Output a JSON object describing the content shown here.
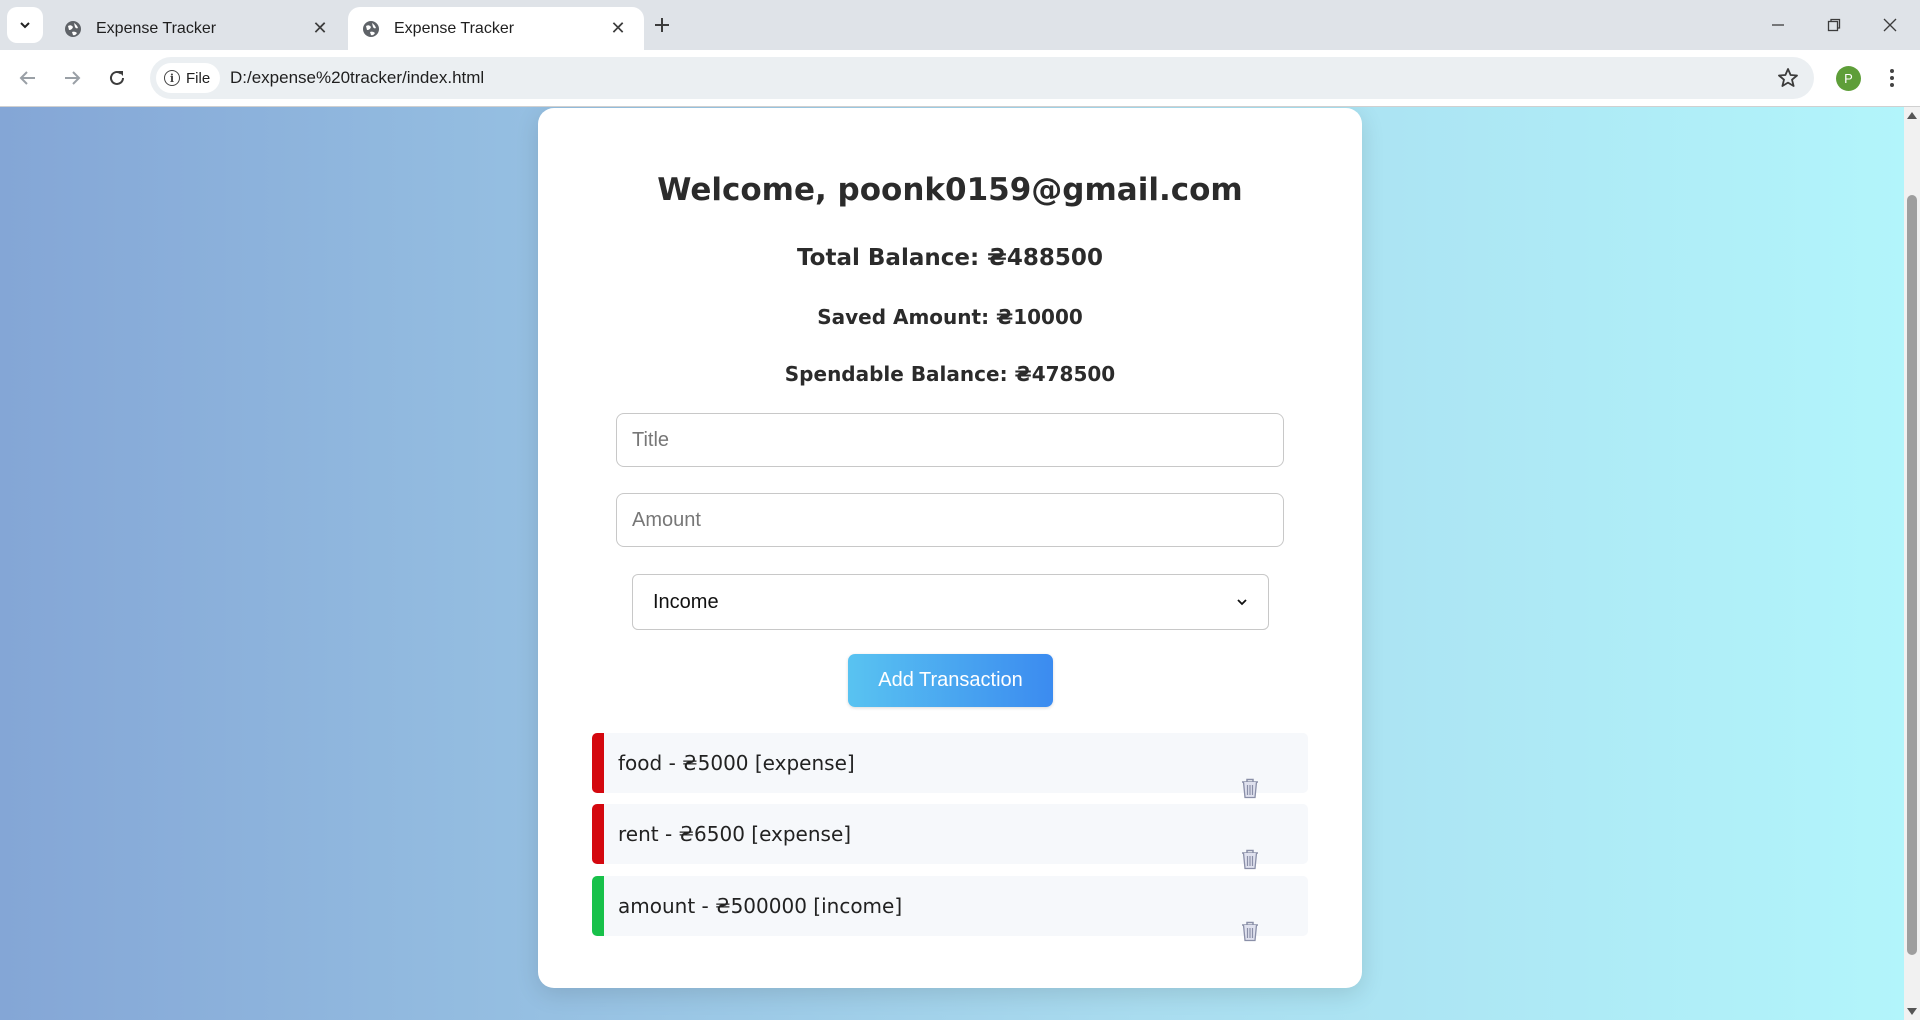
{
  "browser": {
    "tabs": [
      {
        "title": "Expense Tracker",
        "active": false
      },
      {
        "title": "Expense Tracker",
        "active": true
      }
    ],
    "url_chip": "File",
    "url": "D:/expense%20tracker/index.html",
    "profile_initial": "P"
  },
  "page": {
    "welcome": "Welcome, poonk0159@gmail.com",
    "total_balance": "Total Balance: ₴488500",
    "saved_amount": "Saved Amount: ₴10000",
    "spendable_balance": "Spendable Balance: ₴478500",
    "form": {
      "title_placeholder": "Title",
      "amount_placeholder": "Amount",
      "type_selected": "Income",
      "add_button": "Add Transaction"
    },
    "transactions": [
      {
        "text": "food - ₴5000 [expense]",
        "type": "expense"
      },
      {
        "text": "rent - ₴6500 [expense]",
        "type": "expense"
      },
      {
        "text": "amount - ₴500000 [income]",
        "type": "income"
      }
    ]
  },
  "colors": {
    "expense": "#d4080f",
    "income": "#18c14a",
    "button_start": "#59c3f1",
    "button_end": "#3b8bf0",
    "avatar": "#5e9e39"
  },
  "icons": {
    "tab_favicon": "globe-icon",
    "delete": "trash-icon",
    "bookmark": "star-icon"
  }
}
